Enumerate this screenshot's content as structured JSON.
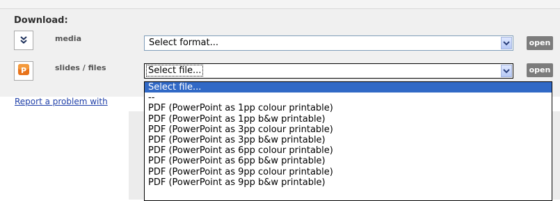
{
  "download": {
    "heading": "Download:",
    "rows": [
      {
        "label": "media",
        "icon": "chevron-down-double-icon",
        "select_value": "Select format...",
        "open_label": "open"
      },
      {
        "label": "slides / files",
        "icon": "powerpoint-icon",
        "select_value": "Select file...",
        "open_label": "open"
      }
    ]
  },
  "report_link": "Report a problem with",
  "dropdown": {
    "options": [
      "Select file...",
      "--",
      "PDF (PowerPoint as 1pp colour printable)",
      "PDF (PowerPoint as 1pp b&w printable)",
      "PDF (PowerPoint as 3pp colour printable)",
      "PDF (PowerPoint as 3pp b&w printable)",
      "PDF (PowerPoint as 6pp colour printable)",
      "PDF (PowerPoint as 6pp b&w printable)",
      "PDF (PowerPoint as 9pp colour printable)",
      "PDF (PowerPoint as 9pp b&w printable)"
    ],
    "selected_index": 0
  },
  "colors": {
    "highlight": "#3169c6",
    "open_button": "#7c7c7c",
    "link": "#1f3fa8",
    "panel": "#f0f0f0"
  }
}
